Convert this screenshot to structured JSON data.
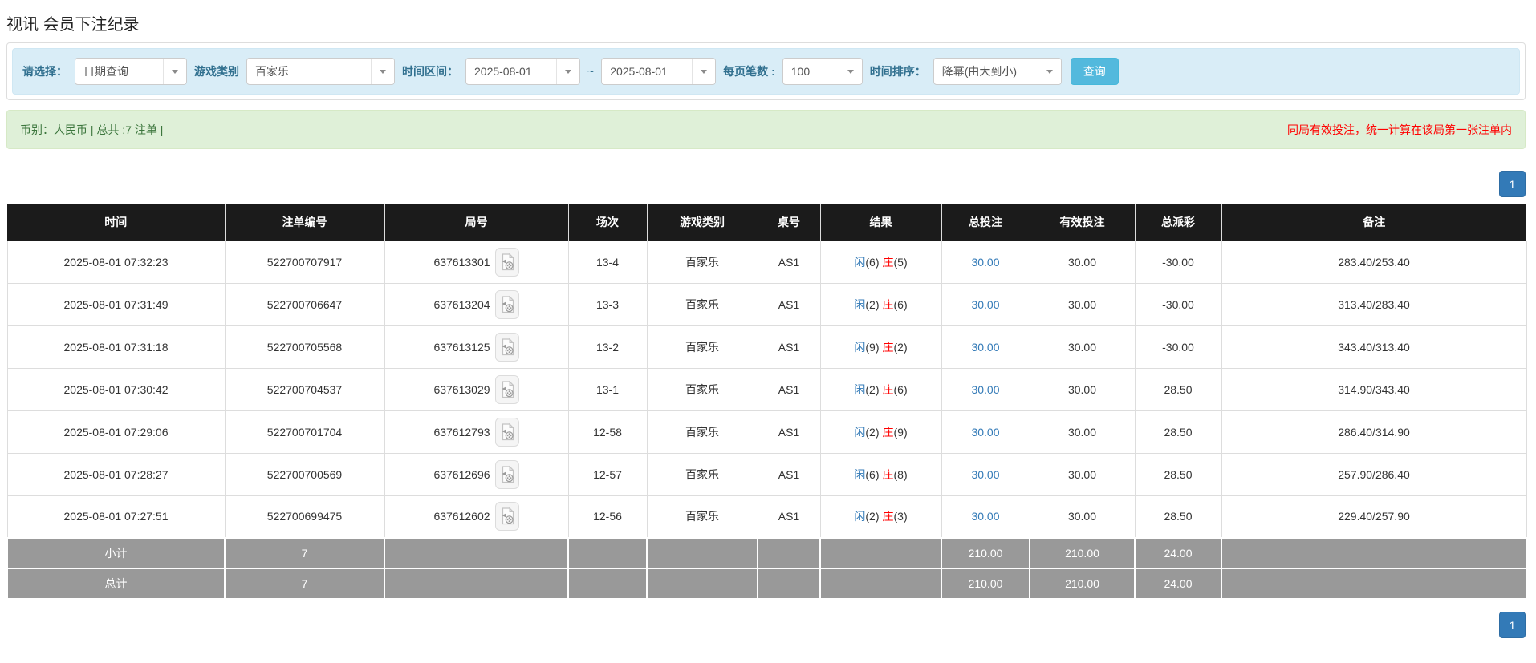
{
  "page_title": "视讯 会员下注纪录",
  "filters": {
    "select_label": "请选择：",
    "select_value": "日期查询",
    "game_type_label": "游戏类别",
    "game_type_value": "百家乐",
    "time_range_label": "时间区间：",
    "date_from": "2025-08-01",
    "date_tilde": "~",
    "date_to": "2025-08-01",
    "page_size_label": "每页笔数 :",
    "page_size_value": "100",
    "sort_label": "时间排序：",
    "sort_value": "降幂(由大到小)",
    "query_button": "查询"
  },
  "summary": {
    "left_text": "币别：人民币 | 总共 :7 注单 |",
    "right_note": "同局有效投注，统一计算在该局第一张注单内"
  },
  "pagination": {
    "page": "1"
  },
  "table": {
    "headers": [
      "时间",
      "注单编号",
      "局号",
      "场次",
      "游戏类别",
      "桌号",
      "结果",
      "总投注",
      "有效投注",
      "总派彩",
      "备注"
    ],
    "rows": [
      {
        "time": "2025-08-01 07:32:23",
        "bet_id": "522700707917",
        "round_id": "637613301",
        "session": "13-4",
        "game": "百家乐",
        "table_no": "AS1",
        "result": {
          "player": "闲",
          "player_score": "(6)",
          "banker": "庄",
          "banker_score": "(5)"
        },
        "total_bet": "30.00",
        "valid_bet": "30.00",
        "payout": "-30.00",
        "remark": "283.40/253.40"
      },
      {
        "time": "2025-08-01 07:31:49",
        "bet_id": "522700706647",
        "round_id": "637613204",
        "session": "13-3",
        "game": "百家乐",
        "table_no": "AS1",
        "result": {
          "player": "闲",
          "player_score": "(2)",
          "banker": "庄",
          "banker_score": "(6)"
        },
        "total_bet": "30.00",
        "valid_bet": "30.00",
        "payout": "-30.00",
        "remark": "313.40/283.40"
      },
      {
        "time": "2025-08-01 07:31:18",
        "bet_id": "522700705568",
        "round_id": "637613125",
        "session": "13-2",
        "game": "百家乐",
        "table_no": "AS1",
        "result": {
          "player": "闲",
          "player_score": "(9)",
          "banker": "庄",
          "banker_score": "(2)"
        },
        "total_bet": "30.00",
        "valid_bet": "30.00",
        "payout": "-30.00",
        "remark": "343.40/313.40"
      },
      {
        "time": "2025-08-01 07:30:42",
        "bet_id": "522700704537",
        "round_id": "637613029",
        "session": "13-1",
        "game": "百家乐",
        "table_no": "AS1",
        "result": {
          "player": "闲",
          "player_score": "(2)",
          "banker": "庄",
          "banker_score": "(6)"
        },
        "total_bet": "30.00",
        "valid_bet": "30.00",
        "payout": "28.50",
        "remark": "314.90/343.40"
      },
      {
        "time": "2025-08-01 07:29:06",
        "bet_id": "522700701704",
        "round_id": "637612793",
        "session": "12-58",
        "game": "百家乐",
        "table_no": "AS1",
        "result": {
          "player": "闲",
          "player_score": "(2)",
          "banker": "庄",
          "banker_score": "(9)"
        },
        "total_bet": "30.00",
        "valid_bet": "30.00",
        "payout": "28.50",
        "remark": "286.40/314.90"
      },
      {
        "time": "2025-08-01 07:28:27",
        "bet_id": "522700700569",
        "round_id": "637612696",
        "session": "12-57",
        "game": "百家乐",
        "table_no": "AS1",
        "result": {
          "player": "闲",
          "player_score": "(6)",
          "banker": "庄",
          "banker_score": "(8)"
        },
        "total_bet": "30.00",
        "valid_bet": "30.00",
        "payout": "28.50",
        "remark": "257.90/286.40"
      },
      {
        "time": "2025-08-01 07:27:51",
        "bet_id": "522700699475",
        "round_id": "637612602",
        "session": "12-56",
        "game": "百家乐",
        "table_no": "AS1",
        "result": {
          "player": "闲",
          "player_score": "(2)",
          "banker": "庄",
          "banker_score": "(3)"
        },
        "total_bet": "30.00",
        "valid_bet": "30.00",
        "payout": "28.50",
        "remark": "229.40/257.90"
      }
    ],
    "subtotal": {
      "label": "小计",
      "count": "7",
      "total_bet": "210.00",
      "valid_bet": "210.00",
      "payout": "24.00"
    },
    "total": {
      "label": "总计",
      "count": "7",
      "total_bet": "210.00",
      "valid_bet": "210.00",
      "payout": "24.00"
    }
  },
  "colors": {
    "accent_blue": "#337ab7",
    "query_button_blue": "#53b9dd",
    "filter_bar_bg": "#d9edf7",
    "summary_bg": "#dff0d8",
    "summary_text_green": "#3c763d",
    "alert_red": "#ff0000",
    "table_header_bg": "#1b1b1b",
    "subtotal_row_bg": "#999999",
    "player_blue": "#337ab7",
    "banker_red": "#ff0000"
  }
}
